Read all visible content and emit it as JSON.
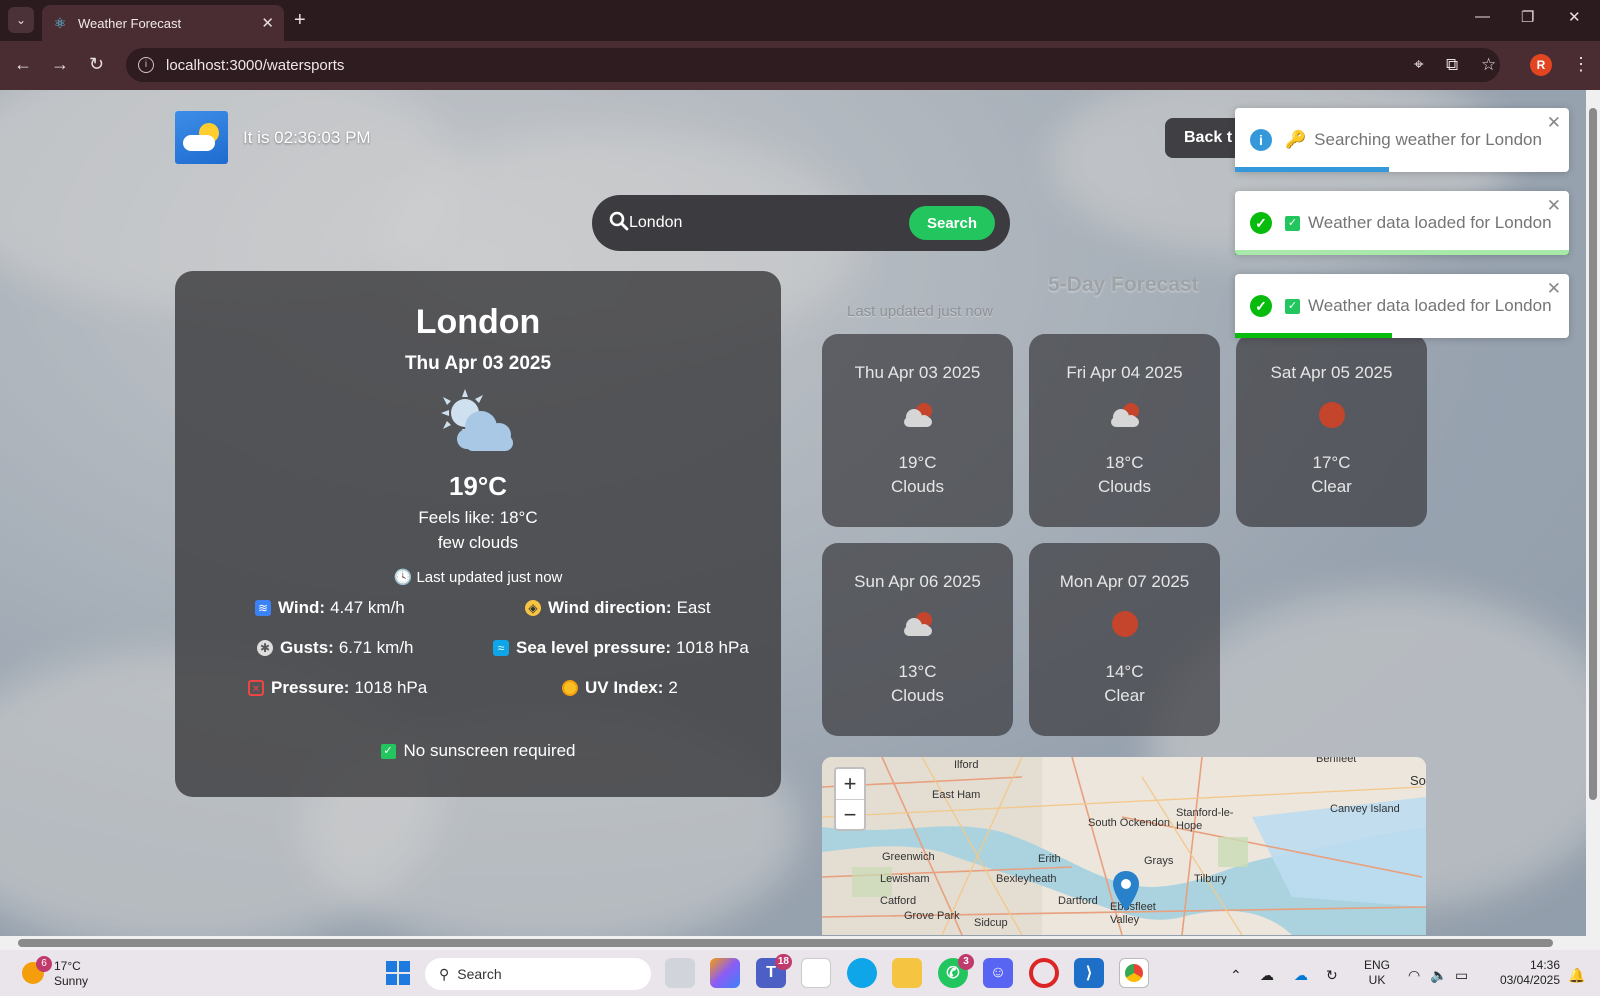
{
  "browser": {
    "tab_title": "Weather Forecast",
    "url": "localhost:3000/watersports",
    "profile_initial": "R"
  },
  "header": {
    "clock_text": "It is 02:36:03 PM",
    "back_button": "Back t"
  },
  "search": {
    "value": "London",
    "button": "Search"
  },
  "current": {
    "city": "London",
    "date": "Thu Apr 03 2025",
    "temperature": "19°C",
    "feels_like": "Feels like: 18°C",
    "description": "few clouds",
    "last_updated": "Last updated just now",
    "details": [
      {
        "label": "Wind:",
        "value": "4.47 km/h",
        "icon": "wind-icon"
      },
      {
        "label": "Wind direction:",
        "value": "East",
        "icon": "compass-icon"
      },
      {
        "label": "Gusts:",
        "value": "6.71 km/h",
        "icon": "gust-icon"
      },
      {
        "label": "Sea level pressure:",
        "value": "1018 hPa",
        "icon": "wave-icon"
      },
      {
        "label": "Pressure:",
        "value": "1018 hPa",
        "icon": "pressure-icon"
      },
      {
        "label": "UV Index:",
        "value": "2",
        "icon": "sun-icon"
      }
    ],
    "sunscreen": "No sunscreen required"
  },
  "forecast": {
    "title": "5-Day Forecast",
    "last_updated": "Last updated just now",
    "days": [
      {
        "date": "Thu Apr 03 2025",
        "temp": "19°C",
        "desc": "Clouds",
        "icon": "cloud-icon"
      },
      {
        "date": "Fri Apr 04 2025",
        "temp": "18°C",
        "desc": "Clouds",
        "icon": "cloud-icon"
      },
      {
        "date": "Sat Apr 05 2025",
        "temp": "17°C",
        "desc": "Clear",
        "icon": "sun-icon"
      },
      {
        "date": "Sun Apr 06 2025",
        "temp": "13°C",
        "desc": "Clouds",
        "icon": "cloud-icon"
      },
      {
        "date": "Mon Apr 07 2025",
        "temp": "14°C",
        "desc": "Clear",
        "icon": "sun-icon"
      }
    ]
  },
  "map": {
    "zoom_in": "+",
    "zoom_out": "−",
    "labels": [
      "Ilford",
      "East Ham",
      "Greenwich",
      "Lewisham",
      "Catford",
      "Grove Park",
      "Sidcup",
      "Bexleyheath",
      "Erith",
      "Dartford",
      "South Ockendon",
      "Grays",
      "Tilbury",
      "Stanford-le-Hope",
      "Canvey Island",
      "Benfleet",
      "Ebbsfleet Valley",
      "So"
    ]
  },
  "toasts": [
    {
      "type": "info",
      "message": "Searching weather for London",
      "progress": 0.46,
      "color": "#3498db",
      "icon_color": "#3498db"
    },
    {
      "type": "success",
      "message": "Weather data loaded for London",
      "progress": 1.0,
      "color": "#07bc0c",
      "icon_color": "#07bc0c"
    },
    {
      "type": "success",
      "message": "Weather data loaded for London",
      "progress": 0.47,
      "color": "#07bc0c",
      "icon_color": "#07bc0c"
    }
  ],
  "taskbar": {
    "weather_temp": "17°C",
    "weather_desc": "Sunny",
    "weather_badge": "6",
    "search_placeholder": "Search",
    "teams_badge": "18",
    "whatsapp_badge": "3",
    "lang": "ENG",
    "region": "UK",
    "time": "14:36",
    "date": "03/04/2025"
  }
}
